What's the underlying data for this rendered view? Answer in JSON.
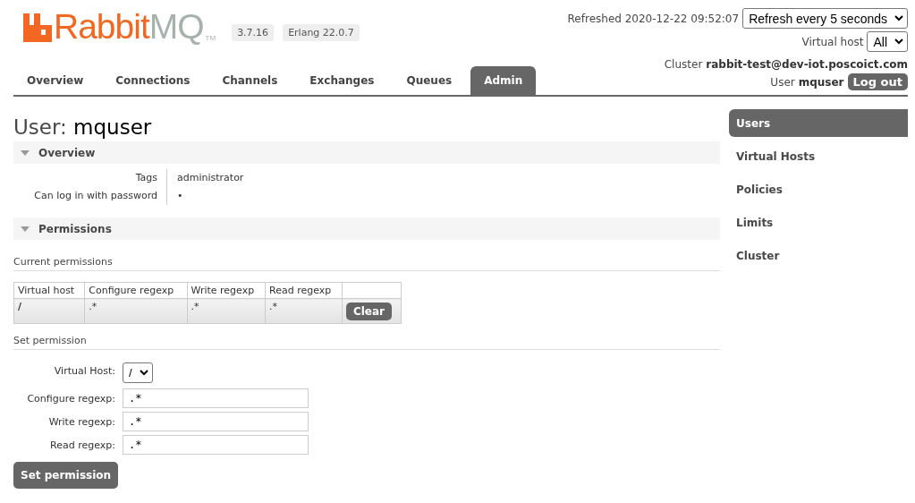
{
  "logo": {
    "brand": "Rabbit",
    "product": "MQ",
    "mark": "TM"
  },
  "badges": [
    "3.7.16",
    "Erlang 22.0.7"
  ],
  "header": {
    "refreshed": "Refreshed 2020-12-22 09:52:07",
    "refresh_select": "Refresh every 5 seconds",
    "vhost_label": "Virtual host",
    "vhost_select": "All",
    "cluster_label": "Cluster",
    "cluster": "rabbit-test@dev-iot.poscoict.com",
    "user_label": "User",
    "user": "mquser",
    "logout": "Log out"
  },
  "tabs": [
    {
      "label": "Overview",
      "selected": false
    },
    {
      "label": "Connections",
      "selected": false
    },
    {
      "label": "Channels",
      "selected": false
    },
    {
      "label": "Exchanges",
      "selected": false
    },
    {
      "label": "Queues",
      "selected": false
    },
    {
      "label": "Admin",
      "selected": true
    }
  ],
  "page_title": {
    "label": "User:",
    "name": "mquser"
  },
  "overview": {
    "title": "Overview",
    "expanded": true,
    "rows": [
      {
        "label": "Tags",
        "value": "administrator"
      },
      {
        "label": "Can log in with password",
        "value": "•"
      }
    ]
  },
  "permissions": {
    "title": "Permissions",
    "expanded": true,
    "current_title": "Current permissions",
    "columns": [
      "Virtual host",
      "Configure regexp",
      "Write regexp",
      "Read regexp"
    ],
    "rows": [
      {
        "vhost": "/",
        "configure": ".*",
        "write": ".*",
        "read": ".*",
        "action": "Clear"
      }
    ]
  },
  "set_permission": {
    "title": "Set permission",
    "vhost_label": "Virtual Host:",
    "vhost_value": "/",
    "fields": [
      {
        "label": "Configure regexp:",
        "value": ".*"
      },
      {
        "label": "Write regexp:",
        "value": ".*"
      },
      {
        "label": "Read regexp:",
        "value": ".*"
      }
    ],
    "submit": "Set permission"
  },
  "sidebar": {
    "items": [
      {
        "label": "Users",
        "selected": true
      },
      {
        "label": "Virtual Hosts",
        "selected": false
      },
      {
        "label": "Policies",
        "selected": false
      },
      {
        "label": "Limits",
        "selected": false
      },
      {
        "label": "Cluster",
        "selected": false
      }
    ]
  }
}
